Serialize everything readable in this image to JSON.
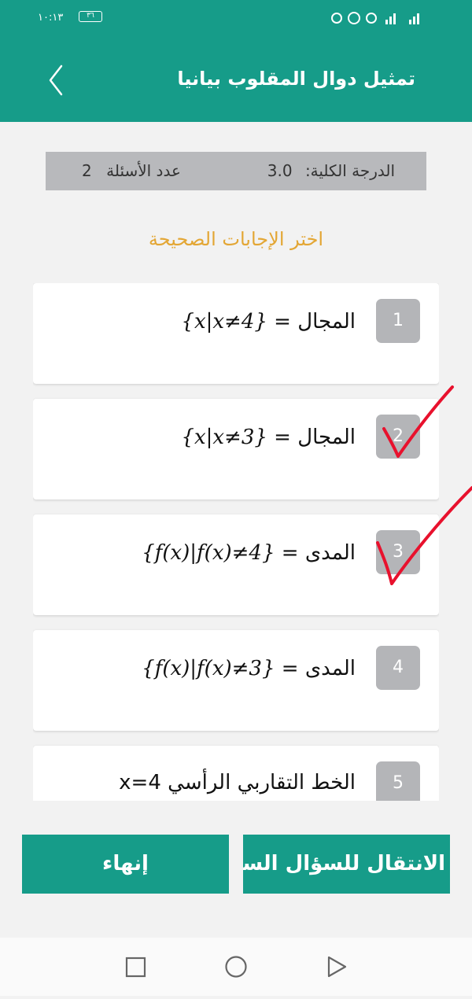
{
  "status": {
    "time": "١٠:١٣",
    "battery": "٣٦"
  },
  "header": {
    "title": "تمثيل دوال المقلوب بيانيا"
  },
  "info": {
    "score_label": "الدرجة الكلية:",
    "score_value": "3.0",
    "count_label": "عدد الأسئلة",
    "count_value": "2"
  },
  "instruction": "اختر الإجابات الصحيحة",
  "options": [
    {
      "number": "1",
      "label": "المجال =",
      "math": "{x|x≠4}",
      "checked": false
    },
    {
      "number": "2",
      "label": "المجال =",
      "math": "{x|x≠3}",
      "checked": true
    },
    {
      "number": "3",
      "label": "المدى =",
      "math": "{f(x)|f(x)≠4}",
      "checked": true
    },
    {
      "number": "4",
      "label": "المدى =",
      "math": "{f(x)|f(x)≠3}",
      "checked": false
    },
    {
      "number": "5",
      "label": "الخط التقاربي الرأسي x=4",
      "math": "",
      "checked": false
    }
  ],
  "buttons": {
    "next_label": "الانتقال للسؤال السابق",
    "finish_label": "إنهاء"
  },
  "colors": {
    "primary": "#169c89",
    "accent": "#e3a634",
    "check": "#e8112d"
  }
}
